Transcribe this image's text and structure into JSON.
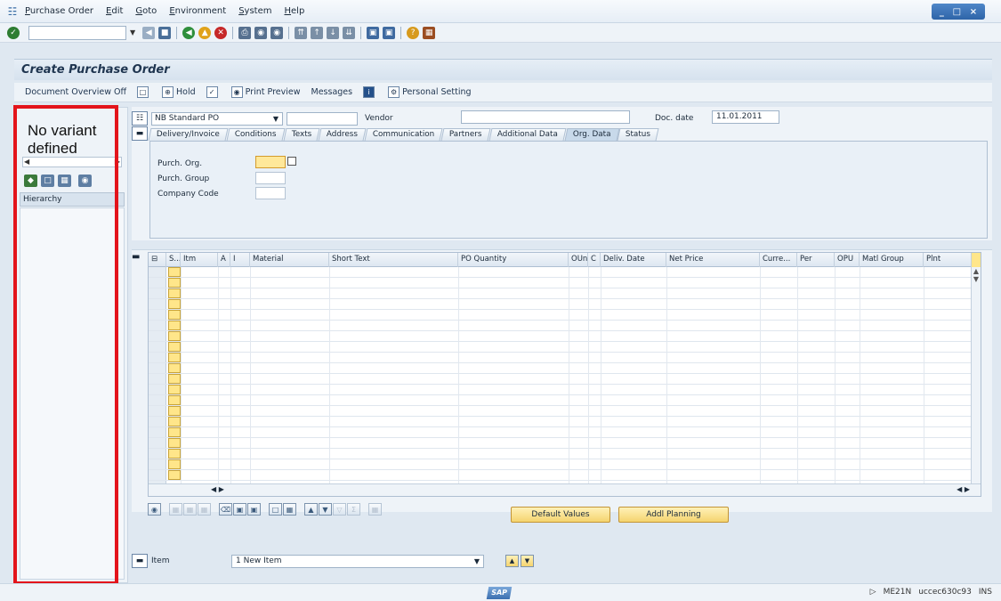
{
  "menu": {
    "items": [
      "Purchase Order",
      "Edit",
      "Goto",
      "Environment",
      "System",
      "Help"
    ]
  },
  "window_controls": [
    "_",
    "□",
    "×"
  ],
  "title": "Create Purchase Order",
  "app_toolbar": {
    "doc_overview": "Document Overview Off",
    "hold": "Hold",
    "print_preview": "Print Preview",
    "messages": "Messages",
    "personal_setting": "Personal Setting"
  },
  "left_nav": {
    "variant_text": "No variant defined",
    "hierarchy": "Hierarchy"
  },
  "header": {
    "order_type": "NB Standard PO",
    "vendor_label": "Vendor",
    "vendor_value": "",
    "doc_date_label": "Doc. date",
    "doc_date_value": "11.01.2011",
    "tabs": [
      "Delivery/Invoice",
      "Conditions",
      "Texts",
      "Address",
      "Communication",
      "Partners",
      "Additional Data",
      "Org. Data",
      "Status"
    ],
    "active_tab": "Org. Data",
    "fields": {
      "purch_org": "Purch. Org.",
      "purch_group": "Purch. Group",
      "company_code": "Company Code"
    }
  },
  "items_table": {
    "columns": [
      "S...",
      "Itm",
      "A",
      "I",
      "Material",
      "Short Text",
      "PO Quantity",
      "OUn",
      "C",
      "Deliv. Date",
      "Net Price",
      "Curre...",
      "Per",
      "OPU",
      "Matl Group",
      "Plnt"
    ],
    "row_count": 20
  },
  "buttons": {
    "default_values": "Default Values",
    "addl_planning": "Addl Planning"
  },
  "item_select": {
    "label": "Item",
    "value": "1 New Item"
  },
  "status": {
    "logo": "SAP",
    "transaction": "ME21N",
    "system": "uccec630c93",
    "mode": "INS"
  }
}
